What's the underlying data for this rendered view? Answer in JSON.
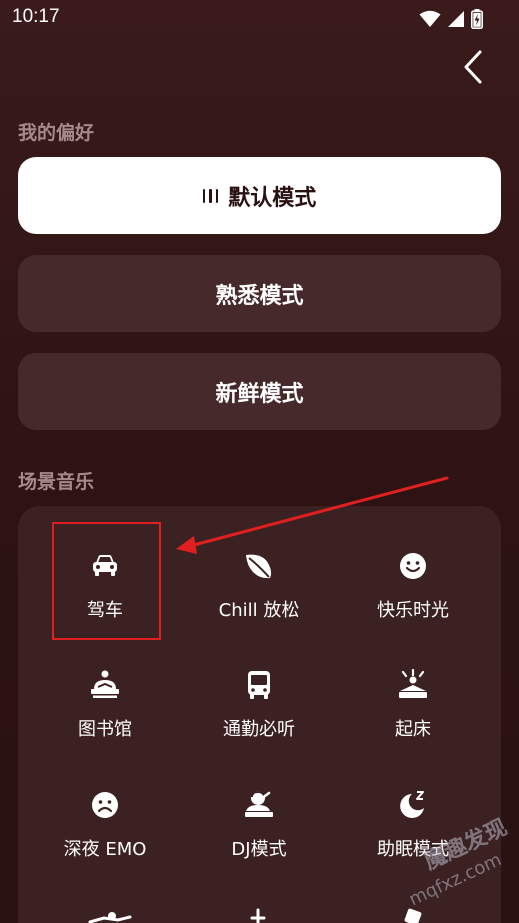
{
  "status_bar": {
    "time": "10:17",
    "icons": [
      "wifi-icon",
      "signal-icon",
      "battery-icon"
    ]
  },
  "header": {
    "back_icon": "chevron-left-icon"
  },
  "preferences": {
    "section_title": "我的偏好",
    "modes": [
      {
        "label": "默认模式",
        "active": true
      },
      {
        "label": "熟悉模式",
        "active": false
      },
      {
        "label": "新鲜模式",
        "active": false
      }
    ]
  },
  "scenes": {
    "section_title": "场景音乐",
    "items": [
      {
        "label": "驾车",
        "icon": "car-icon"
      },
      {
        "label": "Chill 放松",
        "icon": "leaf-icon"
      },
      {
        "label": "快乐时光",
        "icon": "smile-icon"
      },
      {
        "label": "图书馆",
        "icon": "reading-icon"
      },
      {
        "label": "通勤必听",
        "icon": "bus-icon"
      },
      {
        "label": "起床",
        "icon": "wake-up-icon"
      },
      {
        "label": "深夜 EMO",
        "icon": "sad-face-icon"
      },
      {
        "label": "DJ模式",
        "icon": "dj-icon"
      },
      {
        "label": "助眠模式",
        "icon": "moon-sleep-icon"
      }
    ]
  },
  "watermark": {
    "text": "魔趣发现",
    "domain": "mqfxz.com"
  },
  "colors": {
    "background": "#2e1414",
    "card": "#46292a",
    "panel": "#3c2122",
    "active_card": "#ffffff",
    "section_title": "#a48a8a",
    "annotation": "#e02020"
  }
}
